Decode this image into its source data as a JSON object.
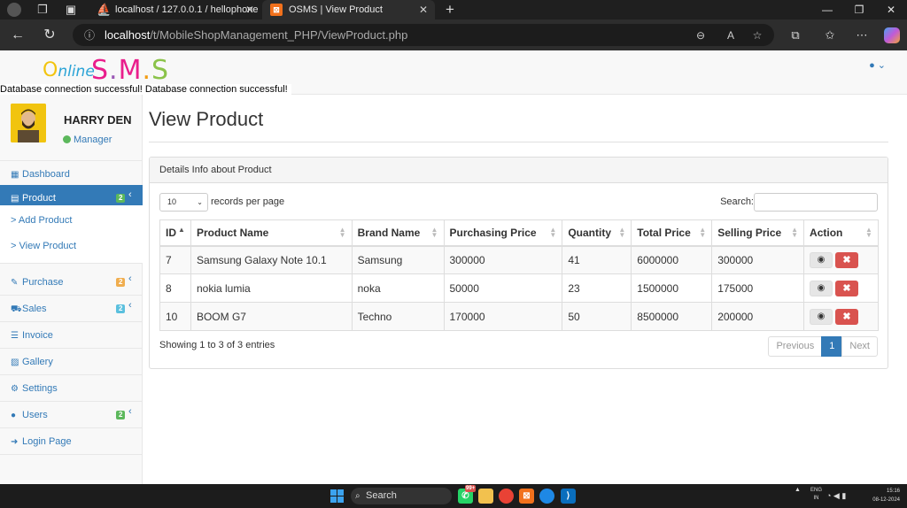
{
  "browser": {
    "tabs": [
      {
        "title": "localhost / 127.0.0.1 / hellophone",
        "favicon": "phpmyadmin-icon"
      },
      {
        "title": "OSMS | View Product",
        "favicon": "xampp-icon",
        "active": true
      }
    ],
    "url_host": "localhost",
    "url_path": "/t/MobileShopManagement_PHP/ViewProduct.php",
    "new_tab_label": "+",
    "window_controls": [
      "minimize",
      "restore",
      "close"
    ]
  },
  "header": {
    "logo_online": "nline",
    "logo_online_o": "O",
    "logo_sms_letters": [
      "S",
      ".",
      "M",
      ".",
      "S"
    ],
    "logo_sms_colors": [
      "#e91e8c",
      "#9b59b6",
      "#e91e8c",
      "#f39c12",
      "#8bc34a"
    ],
    "user_menu_icon": "user-icon"
  },
  "db_message": "Database connection successful! Database connection successful!",
  "profile": {
    "name": "HARRY DEN",
    "role": "Manager",
    "status_color": "#5cb85c"
  },
  "sidebar": {
    "items": [
      {
        "label": "Dashboard",
        "icon": "dashboard-icon"
      },
      {
        "label": "Product",
        "icon": "list-icon",
        "badge": "2",
        "active": true
      },
      {
        "label": "Purchase",
        "icon": "pencil-icon",
        "badge": "2"
      },
      {
        "label": "Sales",
        "icon": "cart-icon",
        "badge": "2"
      },
      {
        "label": "Invoice",
        "icon": "invoice-icon"
      },
      {
        "label": "Gallery",
        "icon": "picture-icon"
      },
      {
        "label": "Settings",
        "icon": "cogs-icon"
      },
      {
        "label": "Users",
        "icon": "user-icon",
        "badge": "2"
      },
      {
        "label": "Login Page",
        "icon": "sign-in-icon"
      }
    ],
    "submenu": [
      "Add Product",
      "View Product"
    ],
    "submenu_prefix": ">"
  },
  "main": {
    "title": "View Product",
    "panel_heading": "Details Info about Product",
    "length_value": "10",
    "length_suffix": "records per page",
    "search_label": "Search:",
    "columns": [
      "ID",
      "Product Name",
      "Brand Name",
      "Purchasing Price",
      "Quantity",
      "Total Price",
      "Selling Price",
      "Action"
    ],
    "rows": [
      {
        "id": "7",
        "product": "Samsung Galaxy Note 10.1",
        "brand": "Samsung",
        "purchase": "300000",
        "qty": "41",
        "total": "6000000",
        "selling": "300000"
      },
      {
        "id": "8",
        "product": "nokia lumia",
        "brand": "noka",
        "purchase": "50000",
        "qty": "23",
        "total": "1500000",
        "selling": "175000"
      },
      {
        "id": "10",
        "product": "BOOM G7",
        "brand": "Techno",
        "purchase": "170000",
        "qty": "50",
        "total": "8500000",
        "selling": "200000"
      }
    ],
    "info": "Showing 1 to 3 of 3 entries",
    "pager": {
      "previous": "Previous",
      "current": "1",
      "next": "Next"
    }
  },
  "taskbar": {
    "search_label": "Search",
    "whatsapp_count": "99+",
    "lang_line1": "ENG",
    "lang_line2": "IN",
    "time": "15:16",
    "date": "08-12-2024"
  }
}
